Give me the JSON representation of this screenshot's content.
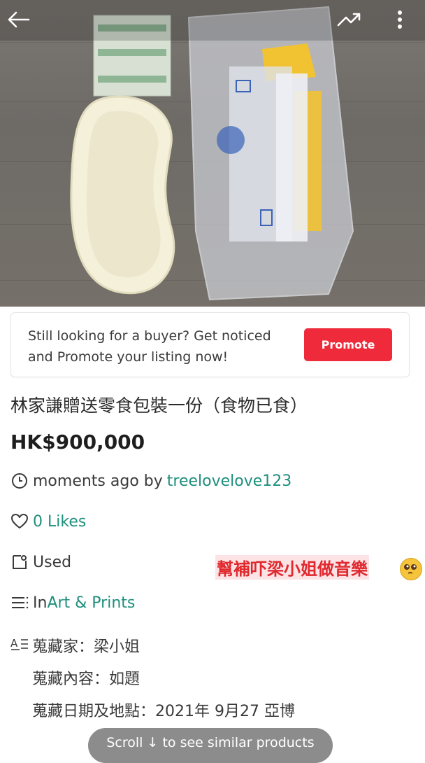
{
  "promo": {
    "line1": "Still looking for a buyer? Get noticed",
    "line2": "and Promote your listing now!",
    "button_label": "Promote"
  },
  "listing": {
    "title": "林家謙贈送零食包裝一份（食物已食）",
    "price": "HK$900,000",
    "time_text": "moments ago by ",
    "seller": "treelovelove123",
    "likes": "0 Likes",
    "condition": "Used",
    "category_prefix": "In ",
    "category": "Art & Prints",
    "overlay_text": "幫補吓梁小姐做音樂",
    "details": [
      "蒐藏家：梁小姐",
      "蒐藏內容：如題",
      "蒐藏日期及地點：2021年 9月27 亞博"
    ]
  },
  "scroll_hint": "Scroll ↓ to see similar products",
  "colors": {
    "accent_green": "#1f8f7d",
    "promote_red": "#ef2a3a"
  }
}
